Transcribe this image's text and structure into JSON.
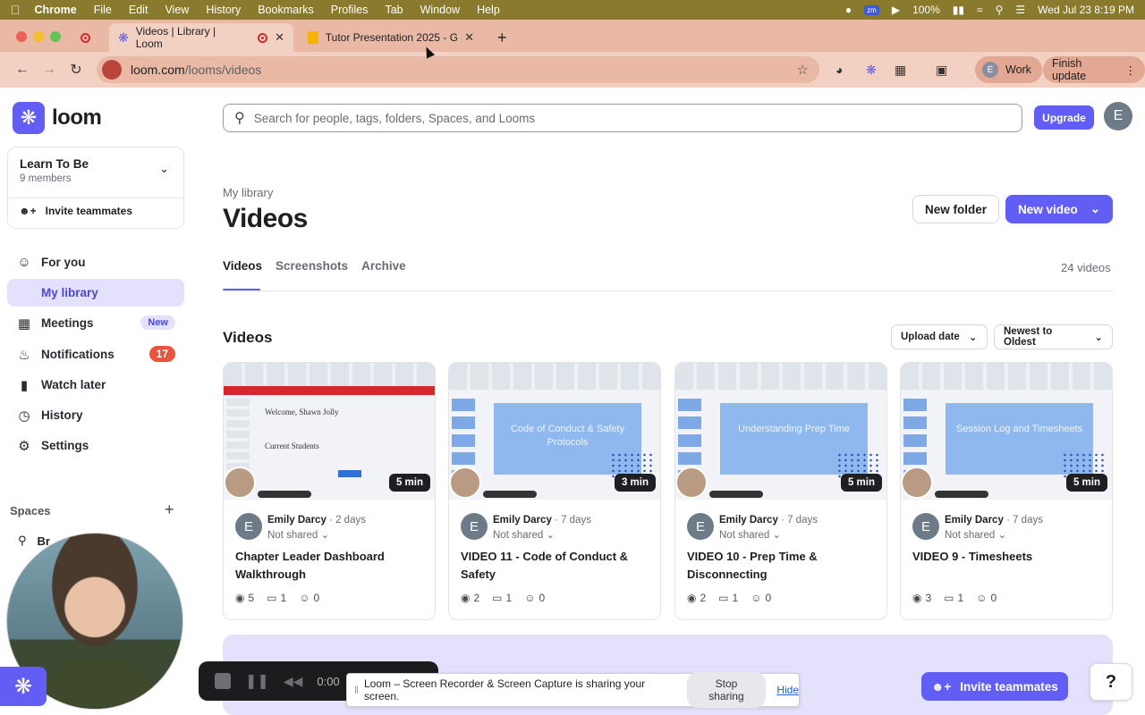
{
  "mac_menu": {
    "app": "Chrome",
    "items": [
      "File",
      "Edit",
      "View",
      "History",
      "Bookmarks",
      "Profiles",
      "Tab",
      "Window",
      "Help"
    ],
    "zoom_badge": "zm",
    "battery": "100%",
    "datetime": "Wed Jul 23  8:19 PM"
  },
  "browser": {
    "tabs": [
      {
        "title": "Videos | Library | Loom"
      },
      {
        "title": "Tutor Presentation 2025 - Go"
      }
    ],
    "url_host": "loom.com",
    "url_path": "/looms/videos",
    "profile_initial": "E",
    "profile_label": "Work",
    "update_label": "Finish update"
  },
  "sidebar": {
    "logo_text": "loom",
    "workspace": {
      "name": "Learn To Be",
      "members": "9 members",
      "invite": "Invite teammates"
    },
    "items": [
      {
        "label": "For you"
      },
      {
        "label": "My library"
      },
      {
        "label": "Meetings",
        "badge": "New"
      },
      {
        "label": "Notifications",
        "badge": "17"
      },
      {
        "label": "Watch later"
      },
      {
        "label": "History"
      },
      {
        "label": "Settings"
      }
    ],
    "spaces_title": "Spaces",
    "space_item": "Br"
  },
  "header": {
    "search_placeholder": "Search for people, tags, folders, Spaces, and Looms",
    "upgrade": "Upgrade",
    "avatar_initial": "E"
  },
  "main": {
    "breadcrumb": "My library",
    "title": "Videos",
    "new_folder": "New folder",
    "new_video": "New video",
    "tabs": [
      {
        "label": "Videos"
      },
      {
        "label": "Screenshots"
      },
      {
        "label": "Archive"
      }
    ],
    "video_count": "24 videos",
    "section_title": "Videos",
    "sort_field": "Upload date",
    "sort_order": "Newest to Oldest",
    "videos": [
      {
        "thumb_style": "doc",
        "thumb_text": "Welcome, Shawn Jolly",
        "thumb_text2": "Current Students",
        "duration": "5 min",
        "owner_initial": "E",
        "owner": "Emily Darcy",
        "age": "2 days",
        "share": "Not shared",
        "title": "Chapter Leader Dashboard Walkthrough",
        "views": "5",
        "comments": "1",
        "reactions": "0"
      },
      {
        "thumb_style": "slide",
        "thumb_text": "Code of Conduct & Safety Protocols",
        "duration": "3 min",
        "owner_initial": "E",
        "owner": "Emily Darcy",
        "age": "7 days",
        "share": "Not shared",
        "title": "VIDEO 11 - Code of Conduct & Safety",
        "views": "2",
        "comments": "1",
        "reactions": "0"
      },
      {
        "thumb_style": "slide",
        "thumb_text": "Understanding Prep Time",
        "duration": "5 min",
        "owner_initial": "E",
        "owner": "Emily Darcy",
        "age": "7 days",
        "share": "Not shared",
        "title": "VIDEO 10 - Prep Time & Disconnecting",
        "views": "2",
        "comments": "1",
        "reactions": "0"
      },
      {
        "thumb_style": "slide",
        "thumb_text": "Session Log and Timesheets",
        "duration": "5 min",
        "owner_initial": "E",
        "owner": "Emily Darcy",
        "age": "7 days",
        "share": "Not shared",
        "title": "VIDEO 9 - Timesheets",
        "views": "3",
        "comments": "1",
        "reactions": "0"
      }
    ]
  },
  "recorder": {
    "time": "0:00"
  },
  "share_banner": {
    "message": "Loom – Screen Recorder & Screen Capture is sharing your screen.",
    "stop": "Stop sharing",
    "hide": "Hide"
  },
  "invite_fab": "Invite teammates",
  "help": "?",
  "colors": {
    "brand": "#625df5",
    "active_bg": "#e3e1fb",
    "badge_red": "#e8553e"
  }
}
